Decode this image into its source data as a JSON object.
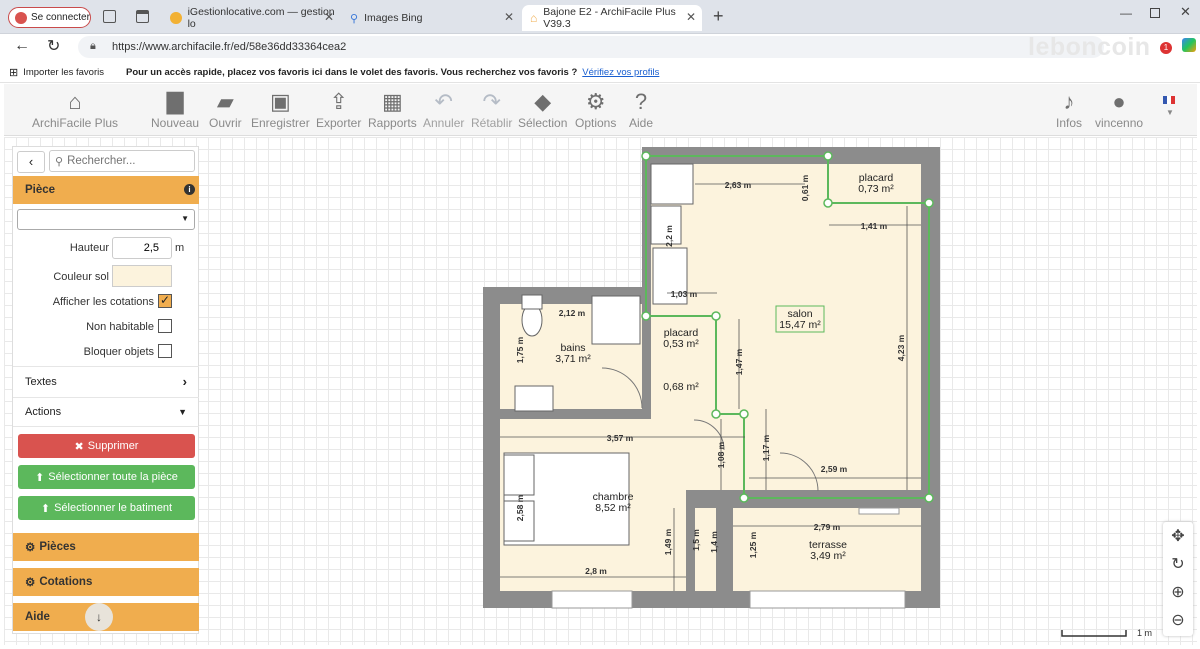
{
  "browser": {
    "sign_in": "Se connecter",
    "tabs": [
      {
        "label": "iGestionlocative.com — gestion lo"
      },
      {
        "label": "Images Bing"
      },
      {
        "label": "Bajone E2 - ArchiFacile Plus V39.3"
      }
    ],
    "url": "https://www.archifacile.fr/ed/58e36dd33364cea2",
    "watermark": "leboncoin",
    "badge": "1",
    "fav_import": "Importer les favoris",
    "fav_text": "Pour un accès rapide, placez vos favoris ici dans le volet des favoris. Vous recherchez vos favoris ?",
    "fav_link": "Vérifiez vos profils"
  },
  "toolbar": {
    "brand": "ArchiFacile Plus",
    "items": [
      "Nouveau",
      "Ouvrir",
      "Enregistrer",
      "Exporter",
      "Rapports",
      "Annuler",
      "Rétablir",
      "Sélection",
      "Options",
      "Aide"
    ],
    "infos": "Infos",
    "user": "vincenno"
  },
  "panel": {
    "search_placeholder": "Rechercher...",
    "section": "Pièce",
    "hauteur_label": "Hauteur",
    "hauteur_value": "2,5",
    "hauteur_unit": "m",
    "couleur_label": "Couleur sol",
    "cotations_label": "Afficher les cotations",
    "non_habitable_label": "Non habitable",
    "bloquer_label": "Bloquer objets",
    "textes": "Textes",
    "actions": "Actions",
    "supprimer": "Supprimer",
    "sel_piece": "Sélectionner toute la pièce",
    "sel_batiment": "Sélectionner le batiment",
    "pieces": "Pièces",
    "cotations": "Cotations",
    "aide": "Aide"
  },
  "plan": {
    "rooms": [
      {
        "name": "salon",
        "area": "15,47 m²"
      },
      {
        "name": "placard",
        "area": "0,73 m²"
      },
      {
        "name": "placard",
        "area": "0,53 m²"
      },
      {
        "name": "",
        "area": "0,68 m²"
      },
      {
        "name": "bains",
        "area": "3,71 m²"
      },
      {
        "name": "chambre",
        "area": "8,52 m²"
      },
      {
        "name": "terrasse",
        "area": "3,49 m²"
      }
    ],
    "dims": [
      "2,63 m",
      "0,61 m",
      "1,41 m",
      "1,03 m",
      "2,12 m",
      "1,75 m",
      "1,47 m",
      "4,23 m",
      "3,57 m",
      "1,08 m",
      "1,17 m",
      "2,59 m",
      "2,58 m",
      "1,49 m",
      "1,5 m",
      "1,4 m",
      "2,8 m",
      "2,79 m",
      "1,25 m",
      "2,2 m"
    ],
    "scale": "1 m"
  }
}
